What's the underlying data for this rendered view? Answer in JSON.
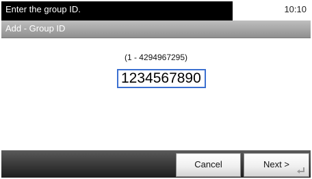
{
  "status": {
    "message": "Enter the group ID.",
    "time": "10:10"
  },
  "title": "Add - Group ID",
  "main": {
    "range": "(1 - 4294967295)",
    "group_id_value": "1234567890"
  },
  "buttons": {
    "cancel": "Cancel",
    "next": "Next >"
  },
  "icons": {
    "next_key": "enter-icon"
  },
  "colors": {
    "status_bg": "#000000",
    "title_bar": "#a8a8a8",
    "field_border": "#3a6fd0",
    "bottom_bar": "#3e3e3e"
  }
}
